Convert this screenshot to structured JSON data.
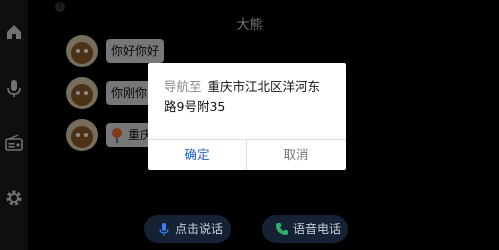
{
  "header": {
    "title": "大熊"
  },
  "sidebar": {
    "items": [
      {
        "icon": "home-icon"
      },
      {
        "icon": "microphone-icon"
      },
      {
        "icon": "radio-icon"
      },
      {
        "icon": "gear-icon"
      }
    ]
  },
  "messages": [
    {
      "text": "你好你好"
    },
    {
      "text": "你刚你"
    },
    {
      "text": "重庆"
    }
  ],
  "dialog": {
    "prefix": "导航至",
    "address_line1": "重庆市江北区洋河东",
    "address_line2": "路9号附35",
    "confirm_label": "确定",
    "cancel_label": "取消"
  },
  "bottom": {
    "voice_label": "点击说话",
    "call_label": "语音电话"
  },
  "colors": {
    "accent": "#2a62c9",
    "call_icon": "#2fb36b",
    "voice_icon": "#3b82f6"
  }
}
